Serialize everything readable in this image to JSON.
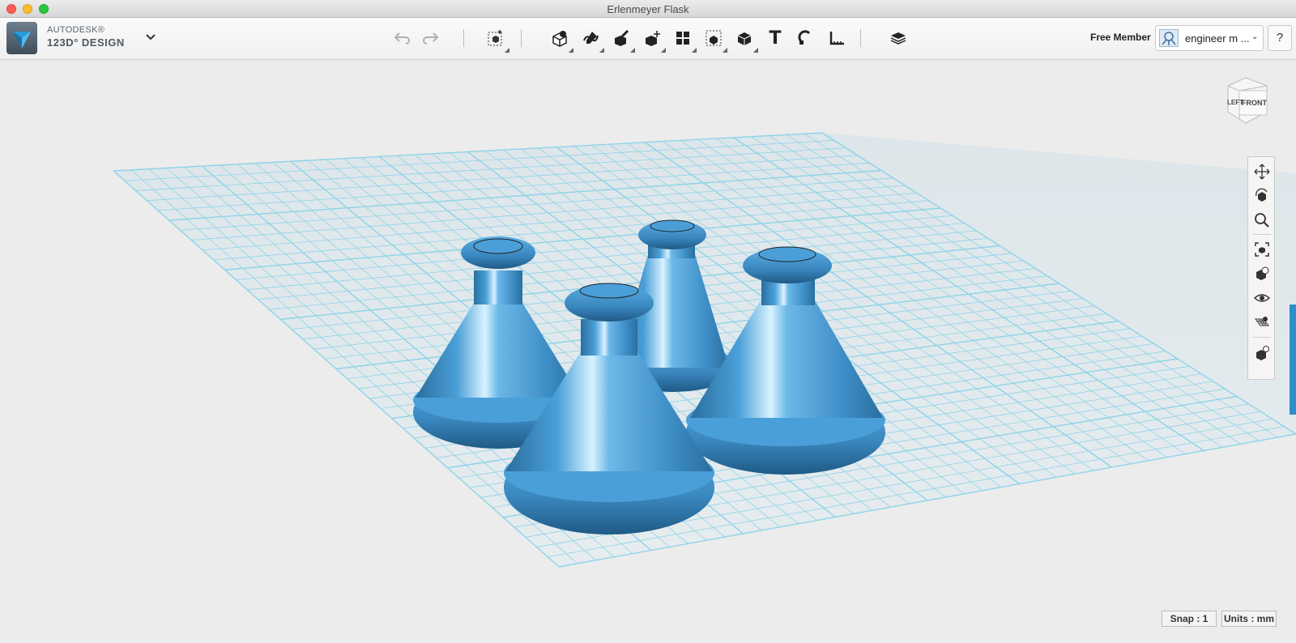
{
  "window": {
    "title": "Erlenmeyer Flask"
  },
  "logo": {
    "brand": "AUTODESK®",
    "product": "123D° DESIGN"
  },
  "toolbar": {
    "icons": [
      "undo-icon",
      "redo-icon",
      "transform-icon",
      "primitives-icon",
      "sketch-icon",
      "construct-icon",
      "modify-icon",
      "pattern-icon",
      "grouping-icon",
      "combine-icon",
      "text-icon",
      "snap-icon",
      "measure-icon",
      "material-icon"
    ]
  },
  "account": {
    "membership": "Free Member",
    "username": "engineer m ...",
    "help_label": "?"
  },
  "viewcube": {
    "left_face": "LEFT",
    "front_face": "FRONT"
  },
  "navigation": {
    "icons": [
      "pan-icon",
      "orbit-icon",
      "zoom-icon",
      "fit-icon",
      "view-mode-icon",
      "visibility-icon",
      "grid-material-icon",
      "snap-settings-icon"
    ]
  },
  "status": {
    "snap": "Snap : 1",
    "units": "Units : mm"
  },
  "colors": {
    "accent": "#2d8fc9",
    "flask": "#4a9fd8",
    "grid": "#7fd0e8"
  }
}
